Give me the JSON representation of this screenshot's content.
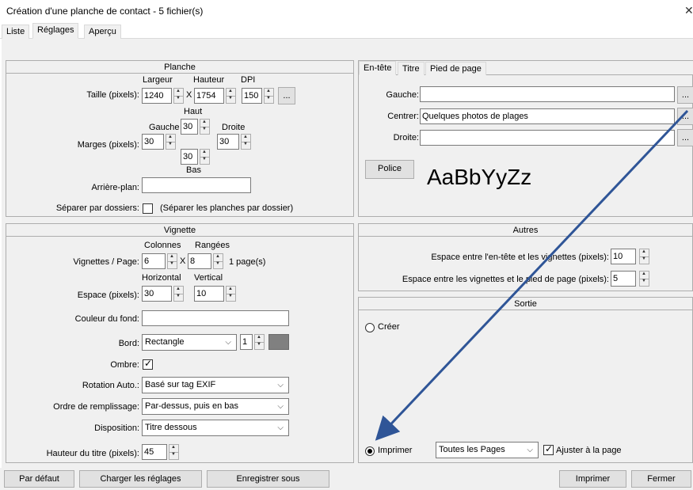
{
  "window": {
    "title": "Création d'une planche de contact - 5 fichier(s)",
    "close": "✕"
  },
  "tabs": [
    "Liste",
    "Réglages",
    "Aperçu"
  ],
  "planche": {
    "title": "Planche",
    "col_largeur": "Largeur",
    "col_hauteur": "Hauteur",
    "col_dpi": "DPI",
    "taille_label": "Taille (pixels):",
    "largeur": "1240",
    "x": "X",
    "hauteur": "1754",
    "dpi": "150",
    "more": "...",
    "haut": "Haut",
    "gauche": "Gauche",
    "droite": "Droite",
    "bas": "Bas",
    "marges_label": "Marges (pixels):",
    "marge_haut": "30",
    "marge_gauche": "30",
    "marge_droite": "30",
    "marge_bas": "30",
    "arriere_label": "Arrière-plan:",
    "arriere_value": "",
    "separer_label": "Séparer par dossiers:",
    "separer_text": "(Séparer les planches par dossier)"
  },
  "header_tabs": [
    "En-tête",
    "Titre",
    "Pied de page"
  ],
  "entete": {
    "gauche_label": "Gauche:",
    "gauche_value": "",
    "centrer_label": "Centrer:",
    "centrer_value": "Quelques photos de plages",
    "droite_label": "Droite:",
    "droite_value": "",
    "more": "...",
    "police_button": "Police",
    "font_sample": "AaBbYyZz"
  },
  "vignette": {
    "title": "Vignette",
    "col_colonnes": "Colonnes",
    "col_rangees": "Rangées",
    "vignettes_label": "Vignettes / Page:",
    "colonnes": "6",
    "x": "X",
    "rangees": "8",
    "pages": "1 page(s)",
    "col_horizontal": "Horizontal",
    "col_vertical": "Vertical",
    "espace_label": "Espace (pixels):",
    "horizontal": "30",
    "vertical": "10",
    "couleur_label": "Couleur du fond:",
    "couleur_value": "",
    "bord_label": "Bord:",
    "bord_value": "Rectangle",
    "bord_width": "1",
    "ombre_label": "Ombre:",
    "rotation_label": "Rotation Auto.:",
    "rotation_value": "Basé sur tag EXIF",
    "ordre_label": "Ordre de remplissage:",
    "ordre_value": "Par-dessus, puis en bas",
    "disposition_label": "Disposition:",
    "disposition_value": "Titre dessous",
    "hauteur_titre_label": "Hauteur du titre (pixels):",
    "hauteur_titre": "45"
  },
  "autres": {
    "title": "Autres",
    "espace_entete_label": "Espace entre l'en-tête et les vignettes (pixels):",
    "espace_entete": "10",
    "espace_pied_label": "Espace entre les vignettes et le pied de page (pixels):",
    "espace_pied": "5"
  },
  "sortie": {
    "title": "Sortie",
    "creer": "Créer",
    "imprimer": "Imprimer",
    "pages_value": "Toutes les Pages",
    "ajuster": "Ajuster à la page"
  },
  "buttons": {
    "defaut": "Par défaut",
    "charger": "Charger les réglages",
    "enregistrer": "Enregistrer sous",
    "imprimer": "Imprimer",
    "fermer": "Fermer"
  },
  "colors": {
    "arrow": "#2f5597",
    "bord_swatch": "#808080"
  }
}
